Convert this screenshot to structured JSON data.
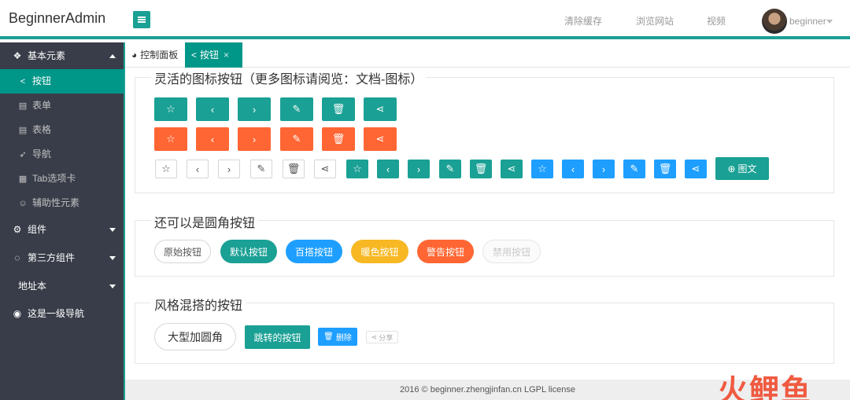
{
  "app": {
    "title": "BeginnerAdmin"
  },
  "header": {
    "links": [
      "清除缓存",
      "浏览网站",
      "视频"
    ],
    "user": "beginner"
  },
  "sidebar": {
    "groups": [
      {
        "label": "基本元素",
        "expanded": true,
        "items": [
          "按钮",
          "表单",
          "表格",
          "导航",
          "Tab选项卡",
          "辅助性元素"
        ]
      },
      {
        "label": "组件"
      },
      {
        "label": "第三方组件"
      },
      {
        "label": "地址本"
      },
      {
        "label": "这是一级导航"
      }
    ]
  },
  "tabs": [
    {
      "label": "控制面板"
    },
    {
      "label": "按钮",
      "close": "×"
    }
  ],
  "sections": {
    "icon_buttons": {
      "title": "灵活的图标按钮（更多图标请阅览：文档-图标）",
      "text_button": "图文"
    },
    "round_buttons": {
      "title": "还可以是圆角按钮",
      "buttons": [
        "原始按钮",
        "默认按钮",
        "百搭按钮",
        "暖色按钮",
        "警告按钮",
        "禁用按钮"
      ]
    },
    "mixed_buttons": {
      "title": "风格混搭的按钮",
      "big": "大型加圆角",
      "jump": "跳转的按钮",
      "delete": "删除",
      "share": "分享"
    }
  },
  "footer": {
    "text": "2016 ©  beginner.zhengjinfan.cn  LGPL license"
  },
  "watermark": "火鲤鱼",
  "colors": {
    "teal": "#1aa094",
    "orange": "#ff6633",
    "blue": "#1e9fff",
    "sidebar": "#393d49",
    "warm": "#f7b824"
  }
}
